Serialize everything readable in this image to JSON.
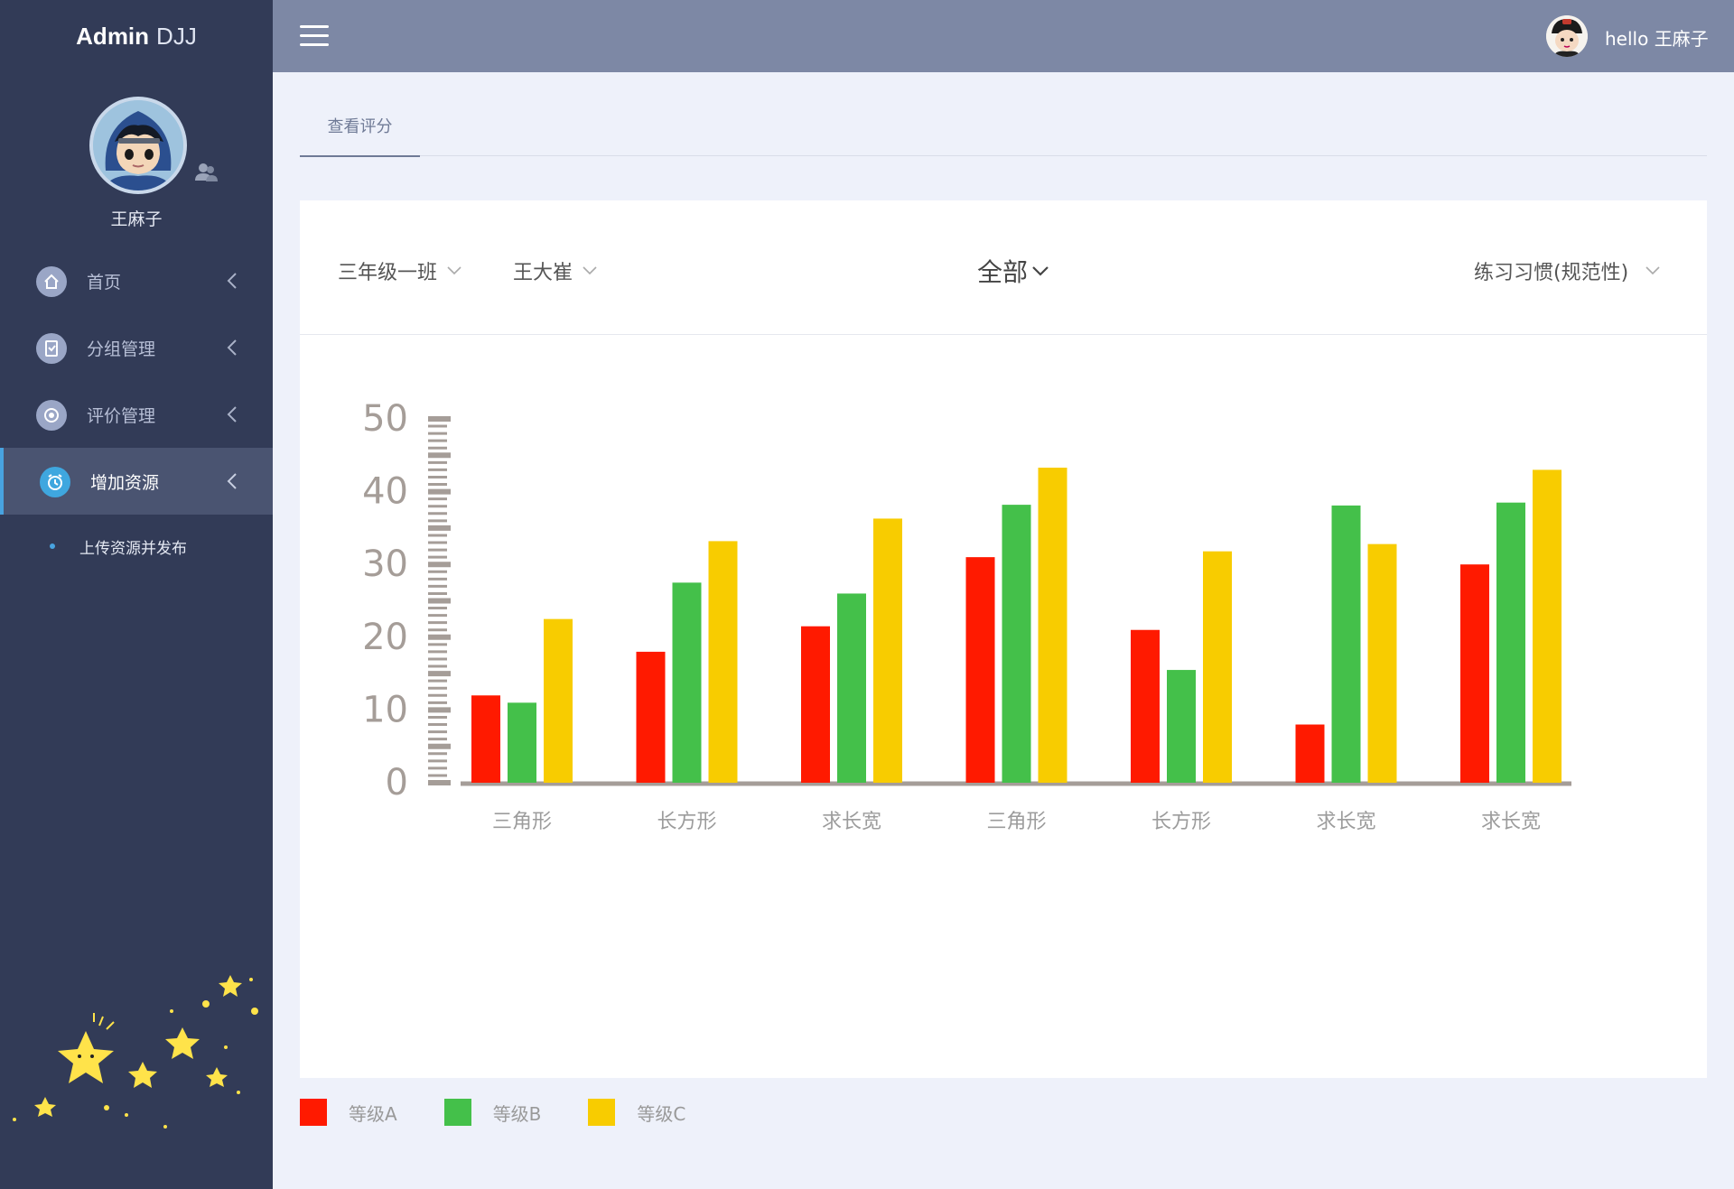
{
  "sidebar": {
    "brand_bold": "Admin",
    "brand_rest": "DJJ",
    "username": "王麻子",
    "items": [
      {
        "label": "首页",
        "icon": "home-icon",
        "active": false
      },
      {
        "label": "分组管理",
        "icon": "clipboard-icon",
        "active": false
      },
      {
        "label": "评价管理",
        "icon": "settings-icon",
        "active": false
      },
      {
        "label": "增加资源",
        "icon": "alarm-icon",
        "active": true
      }
    ],
    "submenu": {
      "label": "上传资源并发布"
    }
  },
  "topbar": {
    "greeting": "hello 王麻子"
  },
  "tabs": [
    {
      "label": "查看评分",
      "active": true
    }
  ],
  "filters": {
    "class": "三年级一班",
    "student": "王大崔",
    "scope": "全部",
    "category": "练习习惯(规范性)"
  },
  "colors": {
    "sidebar_bg": "#323b57",
    "topbar_bg": "#7d88a5",
    "accent": "#48a3e0",
    "grade_a": "#ff1a00",
    "grade_b": "#44c04a",
    "grade_c": "#f8cc00"
  },
  "chart_data": {
    "type": "bar",
    "categories": [
      "三角形",
      "长方形",
      "求长宽",
      "三角形",
      "长方形",
      "求长宽",
      "求长宽"
    ],
    "series": [
      {
        "name": "等级A",
        "color": "#ff1a00",
        "values": [
          12,
          18,
          21.5,
          31,
          21,
          8,
          30
        ]
      },
      {
        "name": "等级B",
        "color": "#44c04a",
        "values": [
          11,
          27.5,
          26,
          38.2,
          15.5,
          38.1,
          38.5
        ]
      },
      {
        "name": "等级C",
        "color": "#f8cc00",
        "values": [
          22.5,
          33.2,
          36.3,
          43.3,
          31.8,
          32.8,
          43
        ]
      }
    ],
    "yticks": [
      "0",
      "10",
      "20",
      "30",
      "40",
      "50"
    ],
    "ylim": [
      0,
      50
    ],
    "grid": false,
    "legend": "bottom-left"
  }
}
